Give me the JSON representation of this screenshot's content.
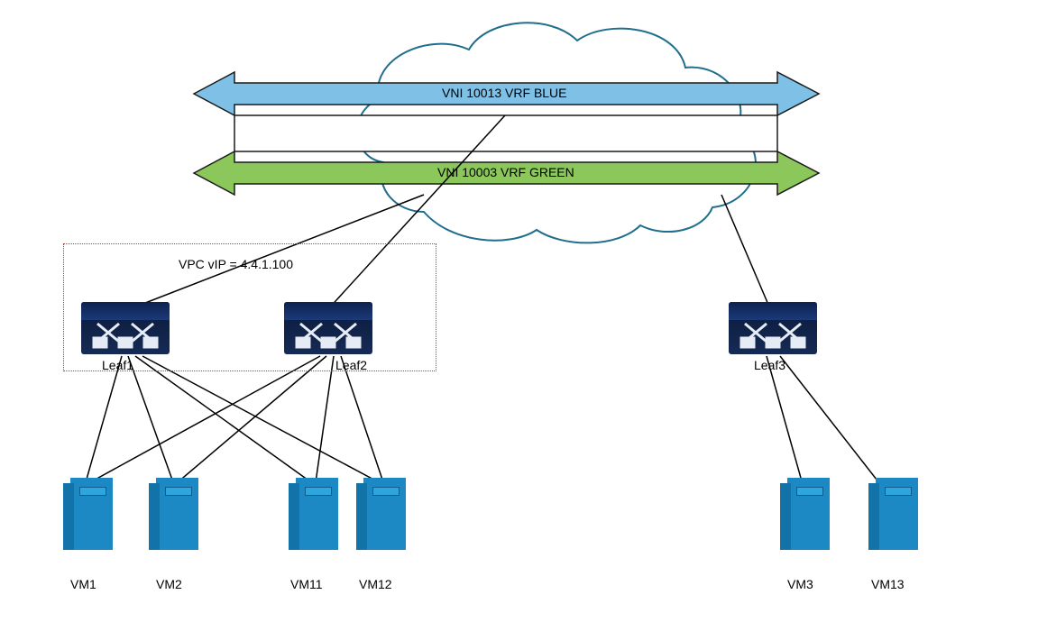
{
  "diagram": {
    "banners": {
      "blue": {
        "text": "VNI 10013 VRF BLUE",
        "fill": "#7fc1e6",
        "stroke": "#1a1a1a"
      },
      "green": {
        "text": "VNI 10003 VRF GREEN",
        "fill": "#8bc75a",
        "stroke": "#1a1a1a"
      }
    },
    "cloud": {
      "stroke": "#1f6e8c"
    },
    "vpc": {
      "label": "VPC vIP = 4.4.1.100"
    },
    "switches": {
      "leaf1": {
        "label": "Leaf1"
      },
      "leaf2": {
        "label": "Leaf2"
      },
      "leaf3": {
        "label": "Leaf3"
      }
    },
    "servers": {
      "vm1": {
        "label": "VM1"
      },
      "vm2": {
        "label": "VM2"
      },
      "vm11": {
        "label": "VM11"
      },
      "vm12": {
        "label": "VM12"
      },
      "vm3": {
        "label": "VM3"
      },
      "vm13": {
        "label": "VM13"
      }
    }
  }
}
